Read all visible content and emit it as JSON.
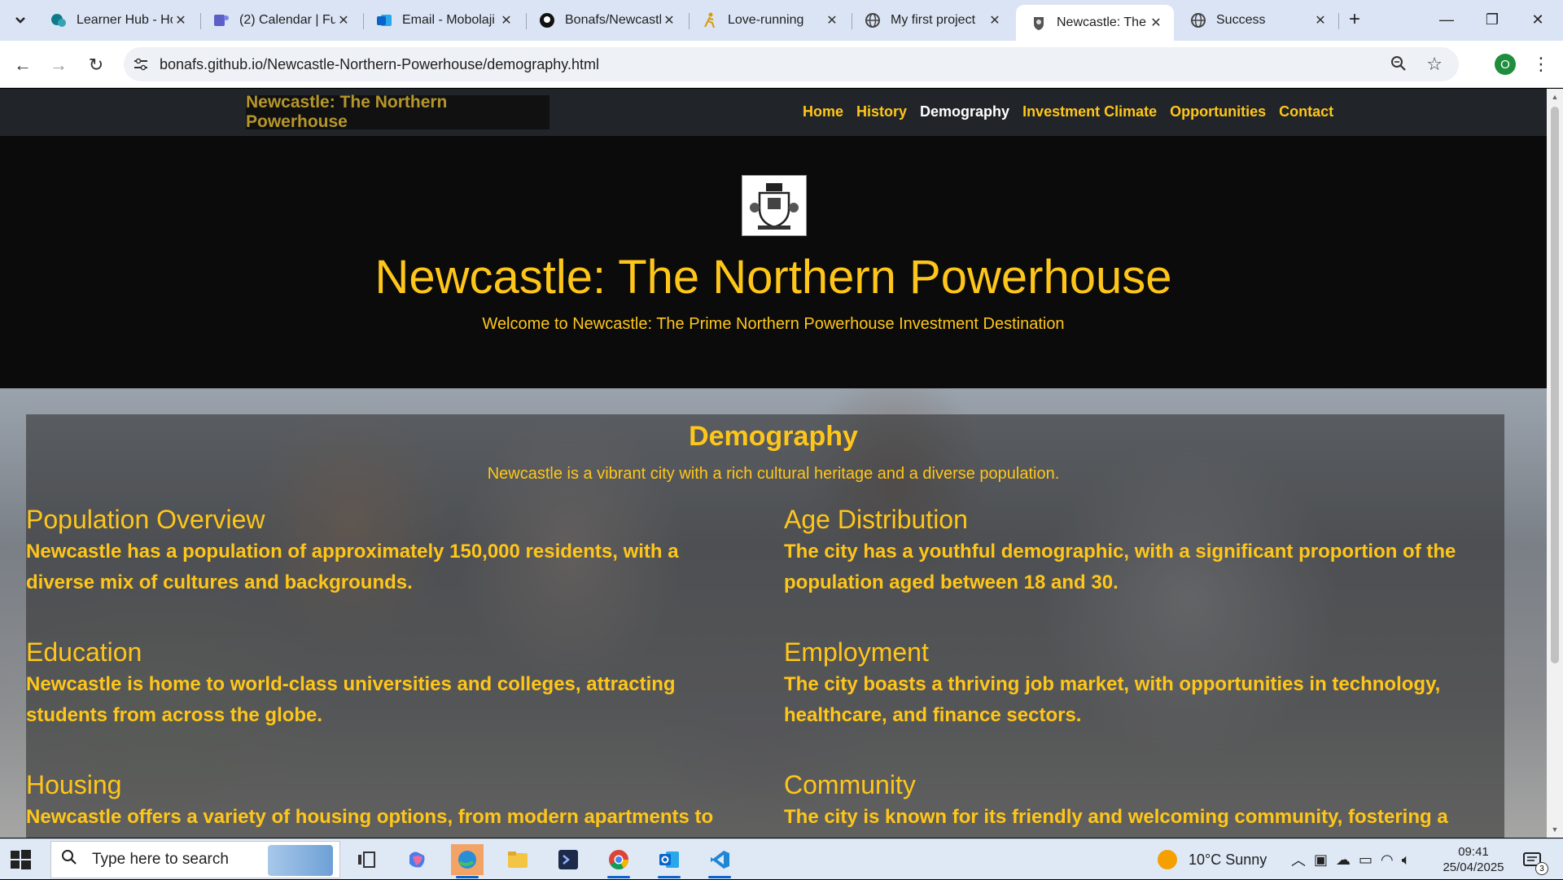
{
  "browser": {
    "tabs": [
      {
        "title": "Learner Hub - Ho",
        "icon": "sharepoint-icon",
        "color": "#0f7b8a"
      },
      {
        "title": "(2) Calendar | Fu",
        "icon": "teams-icon",
        "color": "#5b5fc7"
      },
      {
        "title": "Email - Mobolaji",
        "icon": "outlook-icon",
        "color": "#0a64c8"
      },
      {
        "title": "Bonafs/Newcastl",
        "icon": "github-icon",
        "color": "#111111"
      },
      {
        "title": "Love-running",
        "icon": "running-icon",
        "color": "#d99a00"
      },
      {
        "title": "My first project",
        "icon": "globe-icon",
        "color": "#444444"
      },
      {
        "title": "Newcastle: The N",
        "icon": "crest-icon",
        "color": "#333333",
        "active": true
      },
      {
        "title": "Success",
        "icon": "globe-icon",
        "color": "#444444"
      }
    ],
    "url": "bonafs.github.io/Newcastle-Northern-Powerhouse/demography.html",
    "profile_initial": "O"
  },
  "site": {
    "brand": "Newcastle: The Northern Powerhouse",
    "nav": [
      {
        "label": "Home",
        "active": false
      },
      {
        "label": "History",
        "active": false
      },
      {
        "label": "Demography",
        "active": true
      },
      {
        "label": "Investment Climate",
        "active": false
      },
      {
        "label": "Opportunities",
        "active": false
      },
      {
        "label": "Contact",
        "active": false
      }
    ],
    "hero_title": "Newcastle: The Northern Powerhouse",
    "hero_tagline": "Welcome to Newcastle: The Prime Northern Powerhouse Investment Destination",
    "demography_title": "Demography",
    "demography_intro": "Newcastle is a vibrant city with a rich cultural heritage and a diverse population.",
    "sections": [
      {
        "heading": "Population Overview",
        "text": "Newcastle has a population of approximately 150,000 residents, with a diverse mix of cultures and backgrounds."
      },
      {
        "heading": "Age Distribution",
        "text": "The city has a youthful demographic, with a significant proportion of the population aged between 18 and 30."
      },
      {
        "heading": "Education",
        "text": "Newcastle is home to world-class universities and colleges, attracting students from across the globe."
      },
      {
        "heading": "Employment",
        "text": "The city boasts a thriving job market, with opportunities in technology, healthcare, and finance sectors."
      },
      {
        "heading": "Housing",
        "text": "Newcastle offers a variety of housing options, from modern apartments to"
      },
      {
        "heading": "Community",
        "text": "The city is known for its friendly and welcoming community, fostering a"
      }
    ]
  },
  "taskbar": {
    "search_placeholder": "Type here to search",
    "weather": "10°C  Sunny",
    "time": "09:41",
    "date": "25/04/2025",
    "notifications": "3"
  },
  "colors": {
    "accent_gold": "#ffc61a",
    "nav_bg": "#212529",
    "hero_bg": "#0b0b0b"
  }
}
